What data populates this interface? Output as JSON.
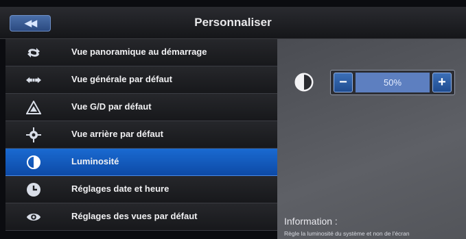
{
  "header": {
    "title": "Personnaliser",
    "back_icon": "rewind-icon",
    "back_glyph": "◀◀"
  },
  "menu": {
    "items": [
      {
        "label": "Vue panoramique au démarrage",
        "icon": "panorama-arrows-icon"
      },
      {
        "label": "Vue générale par défaut",
        "icon": "double-arrow-icon"
      },
      {
        "label": "Vue G/D par défaut",
        "icon": "triangle-warning-icon"
      },
      {
        "label": "Vue arrière par défaut",
        "icon": "target-icon"
      },
      {
        "label": "Luminosité",
        "icon": "brightness-icon",
        "selected": true
      },
      {
        "label": "Réglages date et heure",
        "icon": "clock-icon"
      },
      {
        "label": "Réglages des vues par défaut",
        "icon": "eye-icon"
      }
    ]
  },
  "brightness": {
    "minus_label": "−",
    "plus_label": "+",
    "value": "50%"
  },
  "info": {
    "title": "Information :",
    "text": "Règle la luminosité du système et non de l'écran"
  },
  "colors": {
    "selected": "#1a6ad1",
    "button": "#2b4a80",
    "panel": "#5e6066"
  }
}
